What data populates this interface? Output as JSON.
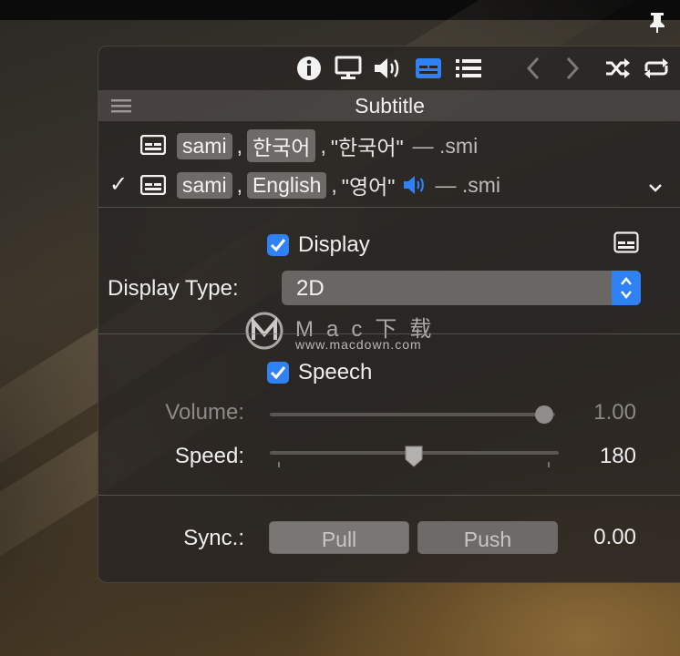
{
  "panel": {
    "title": "Subtitle",
    "tracks": [
      {
        "checked": false,
        "codec": "sami",
        "language": "한국어",
        "name": "\"한국어\"",
        "ext": "— .smi"
      },
      {
        "checked": true,
        "check_mark": "✓",
        "codec": "sami",
        "language": "English",
        "name": "\"영어\"",
        "ext": "— .smi"
      }
    ],
    "display": {
      "checkbox_label": "Display",
      "type_label": "Display Type:",
      "type_value": "2D"
    },
    "speech": {
      "checkbox_label": "Speech",
      "volume_label": "Volume:",
      "volume_value": "1.00",
      "volume_level": 1.0,
      "speed_label": "Speed:",
      "speed_value": "180"
    },
    "sync": {
      "label": "Sync.:",
      "pull_label": "Pull",
      "push_label": "Push",
      "value": "0.00"
    }
  },
  "toolbar_icons": [
    "info-icon",
    "display-icon",
    "volume-icon",
    "subtitle-icon",
    "playlist-icon",
    "back-icon",
    "forward-icon",
    "shuffle-icon",
    "repeat-icon"
  ],
  "watermark": {
    "text": "Mac下载",
    "url": "www.macdown.com"
  },
  "colors": {
    "accent": "#2f82f5",
    "panel_bg": "#2a2624"
  }
}
